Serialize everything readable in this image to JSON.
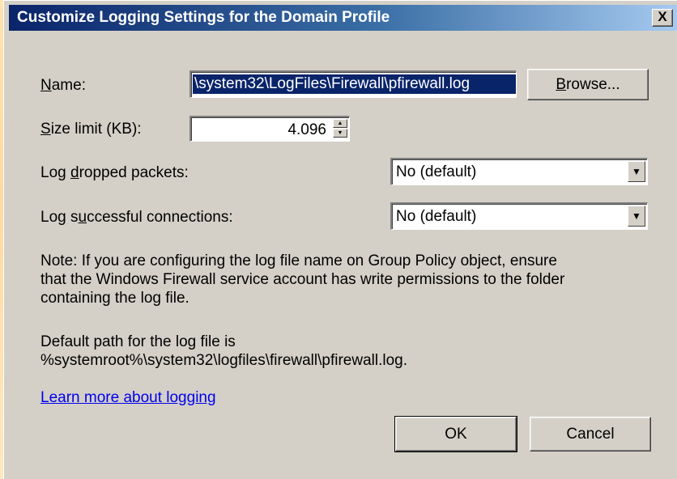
{
  "window": {
    "title": "Customize Logging Settings for the Domain Profile",
    "close_label": "X"
  },
  "name": {
    "label_underlined": "N",
    "label_rest": "ame:",
    "value": "\\system32\\LogFiles\\Firewall\\pfirewall.log",
    "browse_underlined": "B",
    "browse_rest": "rowse..."
  },
  "size_limit": {
    "label_underlined": "S",
    "label_rest": "ize limit (KB):",
    "value": "4.096",
    "spin_up_icon": "up-arrow",
    "spin_down_icon": "down-arrow"
  },
  "log_dropped": {
    "label_pre": "Log ",
    "label_underlined": "d",
    "label_post": "ropped packets:",
    "selected": "No (default)"
  },
  "log_successful": {
    "label_pre": "Log s",
    "label_underlined": "u",
    "label_post": "ccessful connections:",
    "selected": "No (default)"
  },
  "note": {
    "line1": "Note: If you are configuring the log file name on Group Policy object, ensure",
    "line2": "that the Windows Firewall service account has write permissions to the folder",
    "line3": "containing the log file."
  },
  "default_path": {
    "line1": "Default path for the log file is",
    "line2": "%systemroot%\\system32\\logfiles\\firewall\\pfirewall.log."
  },
  "link": {
    "text": "Learn more about logging"
  },
  "buttons": {
    "ok": "OK",
    "cancel": "Cancel"
  },
  "colors": {
    "titlebar_start": "#0a246a",
    "titlebar_end": "#a6caf0",
    "dialog_bg": "#d4d0c8",
    "selection": "#0a246a",
    "link": "#0000ee"
  }
}
